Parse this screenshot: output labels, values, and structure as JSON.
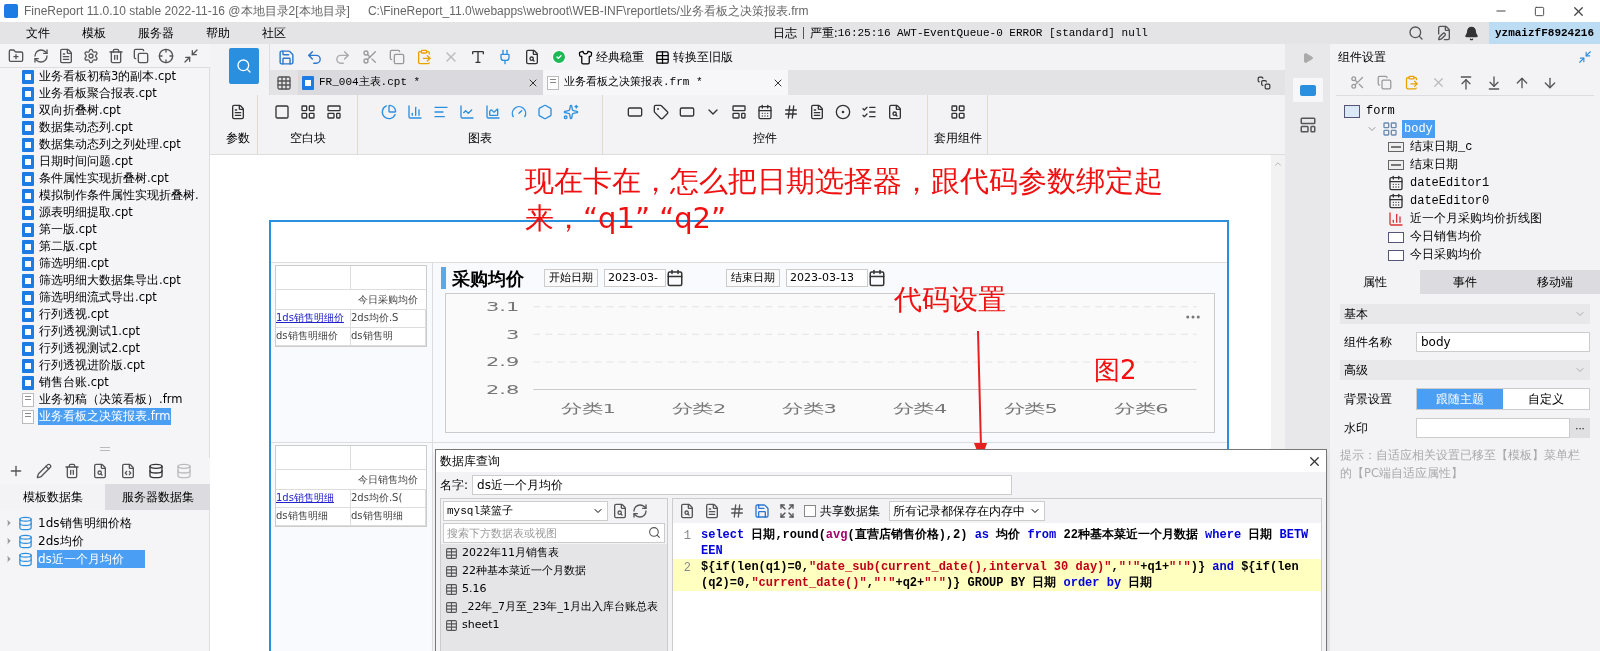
{
  "window": {
    "title": "FineReport 11.0.10 stable 2022-11-16 @本地目录2[本地目录]",
    "path": "C:\\FineReport_11.0\\webapps\\webroot\\WEB-INF\\reportlets/业务看板之决策报表.frm"
  },
  "menu": [
    "文件",
    "模板",
    "服务器",
    "帮助",
    "社区"
  ],
  "log": {
    "label": "日志",
    "severity": "严重:",
    "message": "16:25:16 AWT-EventQueue-0 ERROR [standard] null"
  },
  "user": "yzmaizfF8924216",
  "file_tree": [
    {
      "name": "业务看板初稿3的副本.cpt",
      "kind": "cpt",
      "selected": false
    },
    {
      "name": "业务看板聚合报表.cpt",
      "kind": "cpt",
      "selected": false
    },
    {
      "name": "双向折叠树.cpt",
      "kind": "cpt",
      "selected": false
    },
    {
      "name": "数据集动态列.cpt",
      "kind": "cpt",
      "selected": false
    },
    {
      "name": "数据集动态列之列处理.cpt",
      "kind": "cpt",
      "selected": false
    },
    {
      "name": "日期时间问题.cpt",
      "kind": "cpt",
      "selected": false
    },
    {
      "name": "条件属性实现折叠树.cpt",
      "kind": "cpt",
      "selected": false
    },
    {
      "name": "模拟制作条件属性实现折叠树.",
      "kind": "cpt",
      "selected": false
    },
    {
      "name": "源表明细提取.cpt",
      "kind": "cpt",
      "selected": false
    },
    {
      "name": "第一版.cpt",
      "kind": "cpt",
      "selected": false
    },
    {
      "name": "第二版.cpt",
      "kind": "cpt",
      "selected": false
    },
    {
      "name": "筛选明细.cpt",
      "kind": "cpt",
      "selected": false
    },
    {
      "name": "筛选明细大数据集导出.cpt",
      "kind": "cpt",
      "selected": false
    },
    {
      "name": "筛选明细流式导出.cpt",
      "kind": "cpt",
      "selected": false
    },
    {
      "name": "行列透视.cpt",
      "kind": "cpt",
      "selected": false
    },
    {
      "name": "行列透视测试1.cpt",
      "kind": "cpt",
      "selected": false
    },
    {
      "name": "行列透视测试2.cpt",
      "kind": "cpt",
      "selected": false
    },
    {
      "name": "行列透视进阶版.cpt",
      "kind": "cpt",
      "selected": false
    },
    {
      "name": "销售台账.cpt",
      "kind": "cpt",
      "selected": false
    },
    {
      "name": "业务初稿（决策看板）.frm",
      "kind": "frm",
      "selected": false
    },
    {
      "name": "业务看板之决策报表.frm",
      "kind": "frm",
      "selected": true
    }
  ],
  "dataset_tabs": [
    {
      "label": "模板数据集",
      "selected": true
    },
    {
      "label": "服务器数据集",
      "selected": false
    }
  ],
  "datasets": [
    {
      "name": "1ds销售明细价格",
      "selected": false
    },
    {
      "name": "2ds均价",
      "selected": false
    },
    {
      "name": "ds近一个月均价",
      "selected": true
    }
  ],
  "toolbar_buttons": [
    "经典稳重",
    "转换至旧版"
  ],
  "editor_tabs": [
    {
      "label": "FR_004主表.cpt *",
      "kind": "cpt",
      "selected": false
    },
    {
      "label": "业务看板之决策报表.frm *",
      "kind": "frm",
      "selected": true
    }
  ],
  "component_groups": [
    "参数",
    "空白块",
    "图表",
    "控件",
    "套用组件"
  ],
  "annotations": {
    "question": "现在卡在，怎么把日期选择器，跟代码参数绑定起来，“q1” “q2”",
    "code_note": "代码设置",
    "figure": "图2"
  },
  "report_blocks": [
    {
      "title": "今日采购均价",
      "cells": [
        "1ds销售明细价",
        "2ds均价.S",
        "ds销售明细价",
        "ds销售明"
      ]
    },
    {
      "title": "今日销售均价",
      "cells": [
        "1ds销售明细",
        "2ds均价.S(",
        "ds销售明细",
        "ds销售明细"
      ]
    }
  ],
  "chart_panel": {
    "title": "采购均价",
    "start_label": "开始日期",
    "start_value": "2023-03-",
    "end_label": "结束日期",
    "end_value": "2023-03-13",
    "chart_data": {
      "type": "line",
      "categories": [
        "分类1",
        "分类2",
        "分类3",
        "分类4",
        "分类5",
        "分类6"
      ],
      "ylim": [
        2.8,
        3.1
      ],
      "yticks": [
        2.8,
        2.9,
        3,
        3.1
      ]
    }
  },
  "dialog": {
    "title": "数据库查询",
    "name_label": "名字:",
    "name_value": "ds近一个月均价",
    "connection": "mysql菜篮子",
    "search_placeholder": "搜索下方数据表或视图",
    "tables": [
      "2022年11月销售表",
      "22种基本菜近一个月数据",
      "5.16",
      "_22年_7月至_23年_1月出入库台账总表",
      "sheet1"
    ],
    "share": {
      "label": "共享数据集",
      "checked": false
    },
    "storage": "所有记录都保存在内存中",
    "sql": [
      {
        "number": "1",
        "highlighted": false,
        "tokens": [
          {
            "kind": "kw",
            "text": "select"
          },
          {
            "kind": "plain",
            "text": " 日期,round("
          },
          {
            "kind": "fn",
            "text": "avg"
          },
          {
            "kind": "plain",
            "text": "(直营店销售价格),2) "
          },
          {
            "kind": "kw",
            "text": "as"
          },
          {
            "kind": "plain",
            "text": " 均价 "
          },
          {
            "kind": "kw",
            "text": "from"
          },
          {
            "kind": "plain",
            "text": " 22种基本菜近一个月数据 "
          },
          {
            "kind": "kw",
            "text": "where"
          },
          {
            "kind": "plain",
            "text": " 日期 "
          },
          {
            "kind": "kw",
            "text": "BETWEEN"
          }
        ]
      },
      {
        "number": "2",
        "highlighted": true,
        "tokens": [
          {
            "kind": "plain",
            "text": "${if(len(q1)=0,"
          },
          {
            "kind": "str",
            "text": "\"date_sub(current_date(),interval 30 day)\""
          },
          {
            "kind": "plain",
            "text": ","
          },
          {
            "kind": "str",
            "text": "\"'\""
          },
          {
            "kind": "plain",
            "text": "+q1+"
          },
          {
            "kind": "str",
            "text": "\"'\""
          },
          {
            "kind": "plain",
            "text": ")} "
          },
          {
            "kind": "kw",
            "text": "and"
          },
          {
            "kind": "plain",
            "text": " ${if(len(q2)=0,"
          },
          {
            "kind": "str",
            "text": "\"current_date()\""
          },
          {
            "kind": "plain",
            "text": ","
          },
          {
            "kind": "str",
            "text": "\"'\""
          },
          {
            "kind": "plain",
            "text": "+q2+"
          },
          {
            "kind": "str",
            "text": "\"'\""
          },
          {
            "kind": "plain",
            "text": ")}  GROUP BY 日期 "
          },
          {
            "kind": "kw",
            "text": "order by"
          },
          {
            "kind": "plain",
            "text": " 日期"
          }
        ]
      }
    ]
  },
  "component_panel": {
    "title": "组件设置",
    "tree": [
      {
        "name": "form",
        "kind": "form",
        "selected": false,
        "children": [
          {
            "name": "body",
            "kind": "layout",
            "selected": true,
            "expanded": true,
            "children": [
              {
                "name": "结束日期_c",
                "kind": "label",
                "selected": false
              },
              {
                "name": "结束日期",
                "kind": "label",
                "selected": false
              },
              {
                "name": "dateEditor1",
                "kind": "date",
                "selected": false
              },
              {
                "name": "dateEditor0",
                "kind": "date",
                "selected": false
              },
              {
                "name": "近一个月采购均价折线图",
                "kind": "chart",
                "selected": false
              },
              {
                "name": "今日销售均价",
                "kind": "report",
                "selected": false
              },
              {
                "name": "今日采购均价",
                "kind": "report",
                "selected": false
              }
            ]
          }
        ]
      }
    ],
    "tabs": [
      {
        "label": "属性",
        "selected": true
      },
      {
        "label": "事件",
        "selected": false
      },
      {
        "label": "移动端",
        "selected": false
      }
    ],
    "basic": "基本",
    "name_label": "组件名称",
    "name_value": "body",
    "advanced": "高级",
    "background_label": "背景设置",
    "background_options": [
      {
        "label": "跟随主题",
        "selected": true
      },
      {
        "label": "自定义",
        "selected": false
      }
    ],
    "watermark_label": "水印",
    "watermark_button": "···",
    "hint": "提示：自适应相关设置已移至【模板】菜单栏的【PC端自适应属性】"
  }
}
